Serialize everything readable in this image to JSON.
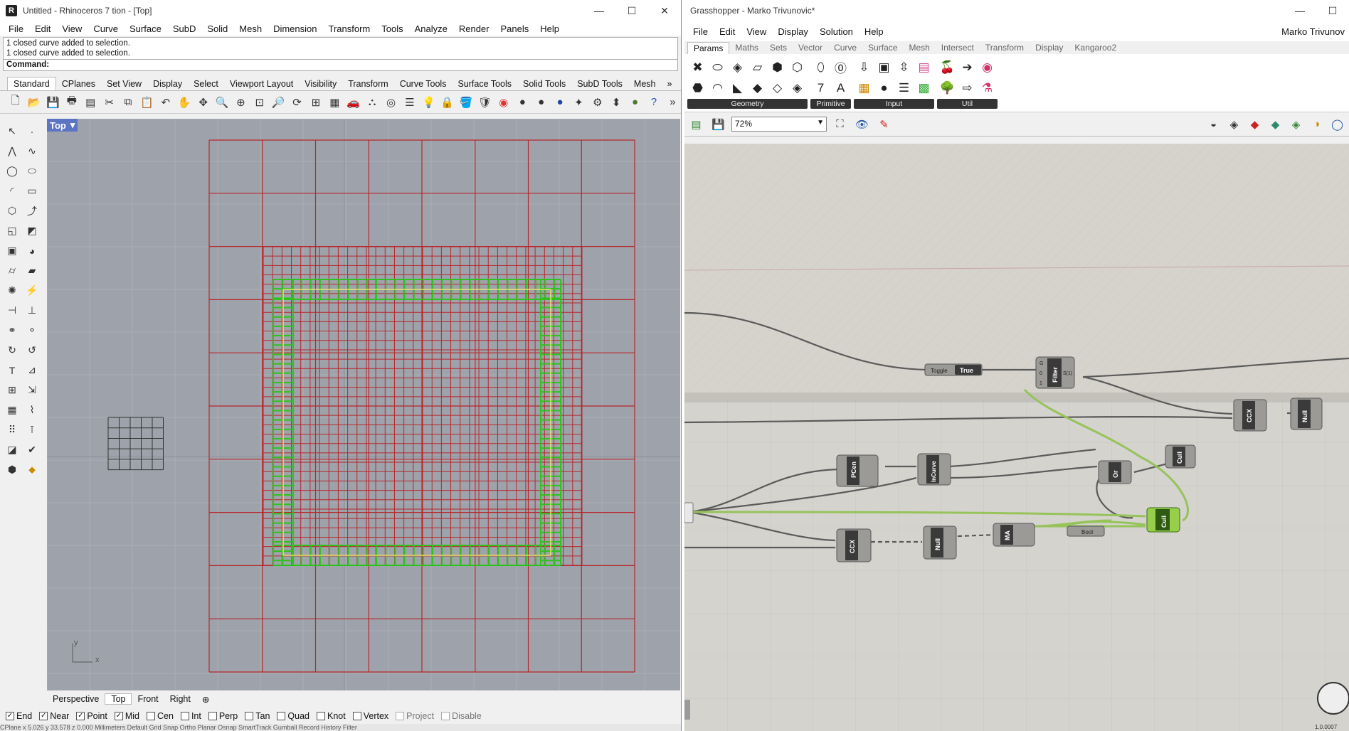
{
  "rhino": {
    "title": "Untitled - Rhinoceros 7 tion - [Top]",
    "menus": [
      "File",
      "Edit",
      "View",
      "Curve",
      "Surface",
      "SubD",
      "Solid",
      "Mesh",
      "Dimension",
      "Transform",
      "Tools",
      "Analyze",
      "Render",
      "Panels",
      "Help"
    ],
    "history": [
      "1 closed curve added to selection.",
      "1 closed curve added to selection."
    ],
    "command_label": "Command:",
    "toolbar_tabs": [
      "Standard",
      "CPlanes",
      "Set View",
      "Display",
      "Select",
      "Viewport Layout",
      "Visibility",
      "Transform",
      "Curve Tools",
      "Surface Tools",
      "Solid Tools",
      "SubD Tools",
      "Mesh"
    ],
    "toolbar_overflow": "»",
    "viewport_name": "Top",
    "axis_x": "x",
    "axis_y": "y",
    "view_tabs": [
      "Perspective",
      "Top",
      "Front",
      "Right"
    ],
    "view_tab_add": "⊕",
    "osnaps": [
      {
        "label": "End",
        "checked": true
      },
      {
        "label": "Near",
        "checked": true
      },
      {
        "label": "Point",
        "checked": true
      },
      {
        "label": "Mid",
        "checked": true
      },
      {
        "label": "Cen",
        "checked": false
      },
      {
        "label": "Int",
        "checked": false
      },
      {
        "label": "Perp",
        "checked": false
      },
      {
        "label": "Tan",
        "checked": false
      },
      {
        "label": "Quad",
        "checked": false
      },
      {
        "label": "Knot",
        "checked": false
      },
      {
        "label": "Vertex",
        "checked": false
      }
    ],
    "project_label": "Project",
    "disable_label": "Disable",
    "status_text": "CPlane   x 5.026   y 33.578   z 0.000   Millimeters   Default   Grid Snap   Ortho   Planar   Osnap   SmartTrack   Gumball   Record History   Filter"
  },
  "gh": {
    "title": "Grasshopper - Marko Trivunovic*",
    "menus": [
      "File",
      "Edit",
      "View",
      "Display",
      "Solution",
      "Help"
    ],
    "user": "Marko Trivunov",
    "tabs": [
      "Params",
      "Maths",
      "Sets",
      "Vector",
      "Curve",
      "Surface",
      "Mesh",
      "Intersect",
      "Transform",
      "Display",
      "Kangaroo2"
    ],
    "groups": [
      "Geometry",
      "Primitive",
      "Input",
      "Util"
    ],
    "zoom": "72%",
    "version": "1.0.0007",
    "nodes": {
      "toggle_label": "Toggle",
      "toggle_value": "True",
      "filter": "Filter",
      "filter_inputs": [
        "G",
        "0",
        "1"
      ],
      "filter_output": "S(1)",
      "ccx_top": "CCX",
      "null_top": "Null",
      "pcen": "PCen",
      "incurve": "InCurve",
      "or": "Or",
      "cull_top": "Cull",
      "cull_green": "Cull",
      "ccx_bottom": "CCX",
      "null_bottom": "Null",
      "ma": "MA",
      "bool": "Bool"
    }
  }
}
